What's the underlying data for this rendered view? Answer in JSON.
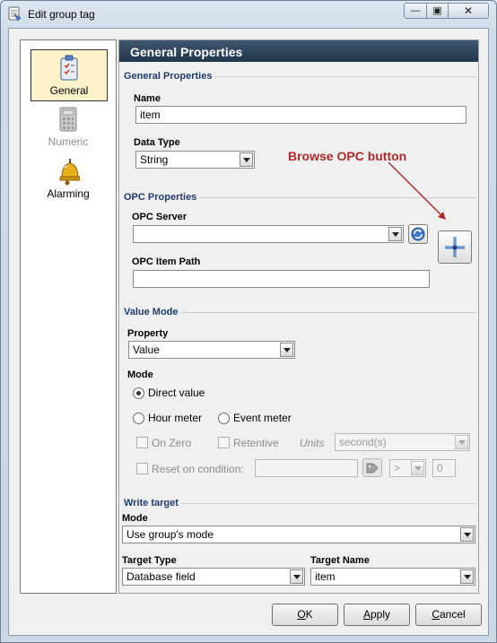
{
  "window": {
    "title": "Edit group tag",
    "close_glyph": "✕",
    "minimize_glyph": "—",
    "maximize_glyph": "▣"
  },
  "nav": {
    "items": [
      {
        "label": "General",
        "icon": "clipboard-icon",
        "selected": true
      },
      {
        "label": "Numeric",
        "icon": "calculator-icon",
        "disabled": true
      },
      {
        "label": "Alarming",
        "icon": "bell-icon"
      }
    ]
  },
  "panel": {
    "header": "General Properties"
  },
  "general": {
    "group_title": "General Properties",
    "name_label": "Name",
    "name_value": "item",
    "data_type_label": "Data Type",
    "data_type_value": "String"
  },
  "opc": {
    "group_title": "OPC Properties",
    "server_label": "OPC Server",
    "server_value": "",
    "item_path_label": "OPC Item Path",
    "item_path_value": ""
  },
  "annotation": {
    "text": "Browse OPC button",
    "color": "#b12a2a"
  },
  "value_mode": {
    "group_title": "Value Mode",
    "property_label": "Property",
    "property_value": "Value",
    "mode_label": "Mode",
    "direct_value": "Direct value",
    "hour_meter": "Hour meter",
    "event_meter": "Event meter",
    "on_zero": "On Zero",
    "retentive": "Retentive",
    "units_label": "Units",
    "units_value": "second(s)",
    "reset_on_condition": "Reset on condition:",
    "operator_value": ">",
    "threshold_value": "0"
  },
  "write_target": {
    "group_title": "Write target",
    "mode_label": "Mode",
    "mode_value": "Use group's mode",
    "target_type_label": "Target Type",
    "target_type_value": "Database field",
    "target_name_label": "Target Name",
    "target_name_value": "item"
  },
  "buttons": {
    "ok_mnemonic": "O",
    "ok_rest": "K",
    "apply_mnemonic": "A",
    "apply_rest": "pply",
    "cancel_mnemonic": "C",
    "cancel_rest": "ancel"
  },
  "colors": {
    "header_bg": "#2d4459",
    "group_title": "#1e3c6e",
    "selected_nav": "#fdf2c8"
  }
}
